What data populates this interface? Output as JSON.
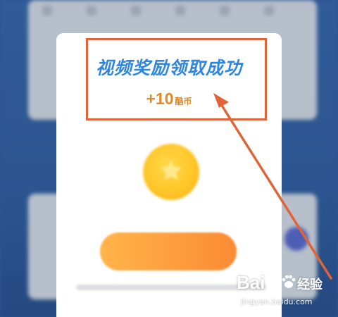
{
  "dialog": {
    "title": "视频奖励领取成功",
    "reward_amount": "+10",
    "reward_unit": "酷币"
  },
  "colors": {
    "title": "#2e86e0",
    "reward": "#e08a24",
    "annotation": "#e0643a",
    "cta": "#fb8a34"
  },
  "icons": {
    "coin": "coin-star-icon"
  },
  "watermark": {
    "logo": "Bai",
    "label": "经验",
    "url": "jingyan.baidu.com"
  }
}
